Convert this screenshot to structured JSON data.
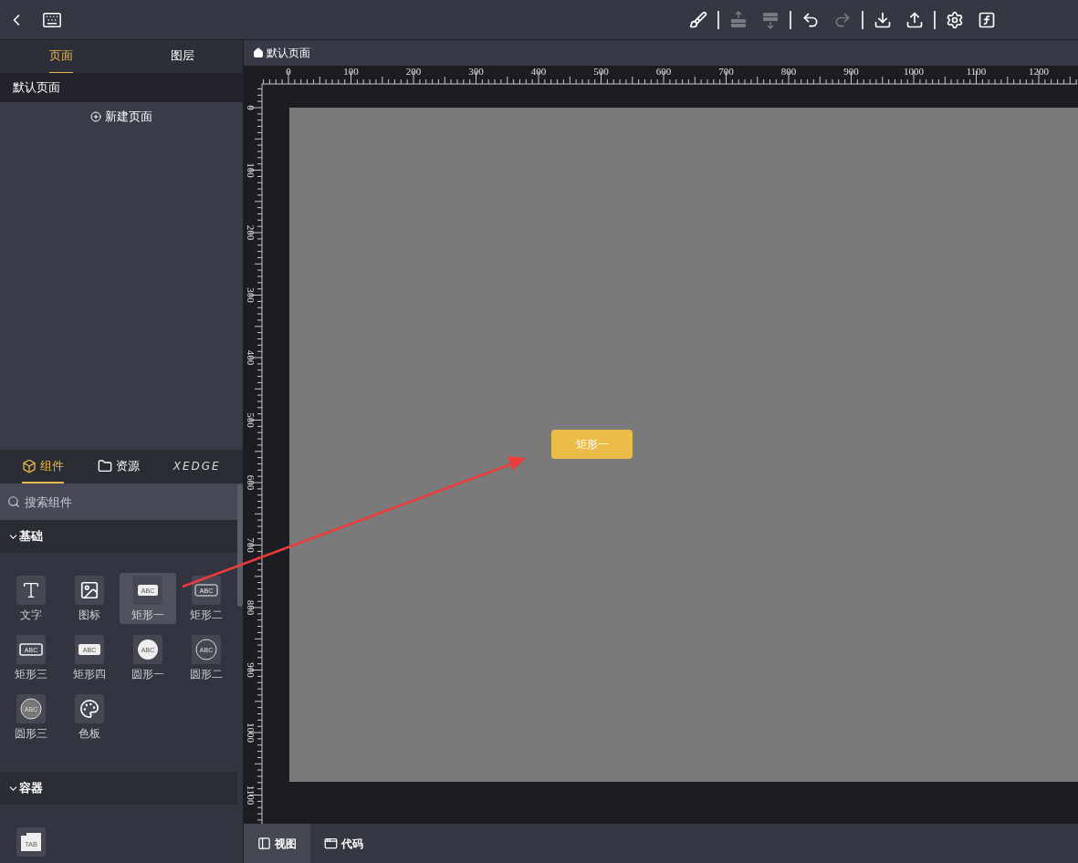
{
  "top_bar": {
    "toolbar": [
      {
        "kind": "brush",
        "disabled": false
      },
      {
        "kind": "separator"
      },
      {
        "kind": "layer-up",
        "disabled": true
      },
      {
        "kind": "layer-down",
        "disabled": true
      },
      {
        "kind": "separator"
      },
      {
        "kind": "undo",
        "disabled": false
      },
      {
        "kind": "redo",
        "disabled": true
      },
      {
        "kind": "separator"
      },
      {
        "kind": "download",
        "disabled": false
      },
      {
        "kind": "upload",
        "disabled": false
      },
      {
        "kind": "separator"
      },
      {
        "kind": "settings",
        "disabled": false
      },
      {
        "kind": "function",
        "disabled": false
      }
    ]
  },
  "left_panel": {
    "tabs": [
      {
        "label": "页面",
        "selected": true
      },
      {
        "label": "图层",
        "selected": false
      }
    ],
    "pages": [
      {
        "label": "默认页面",
        "selected": true
      }
    ],
    "new_page_button": "新建页面"
  },
  "library": {
    "tabs": [
      {
        "kind": "component",
        "label": "组件",
        "selected": true
      },
      {
        "kind": "folder",
        "label": "资源",
        "selected": false
      },
      {
        "kind": "logo",
        "label": "XEDGE",
        "selected": false
      }
    ],
    "search": {
      "placeholder": "搜索组件"
    },
    "sections": [
      {
        "title": "基础",
        "expanded": true,
        "items": [
          {
            "kind": "text",
            "label": "文字",
            "selected": false
          },
          {
            "kind": "image",
            "label": "图标",
            "selected": false
          },
          {
            "kind": "rect-filled",
            "glyph": "ABC",
            "label": "矩形一",
            "selected": true
          },
          {
            "kind": "rect-outline",
            "glyph": "ABC",
            "label": "矩形二",
            "selected": false
          },
          {
            "kind": "rect-outline-bold",
            "glyph": "ABC",
            "label": "矩形三",
            "selected": false
          },
          {
            "kind": "rect-wide",
            "glyph": "ABC",
            "label": "矩形四",
            "selected": false
          },
          {
            "kind": "circle-filled",
            "glyph": "ABC",
            "label": "圆形一",
            "selected": false
          },
          {
            "kind": "circle-outline",
            "glyph": "ABC",
            "label": "圆形二",
            "selected": false
          },
          {
            "kind": "circle-gray",
            "glyph": "ABC",
            "label": "圆形三",
            "selected": false
          },
          {
            "kind": "palette",
            "label": "色板",
            "selected": false
          }
        ]
      },
      {
        "title": "容器",
        "expanded": true,
        "items": [
          {
            "kind": "tab",
            "glyph": "TAB",
            "selected": false
          }
        ]
      }
    ]
  },
  "breadcrumb": "默认页面",
  "ruler": {
    "x_labels": [
      "0",
      "100",
      "200",
      "300",
      "400",
      "500",
      "600",
      "700",
      "800",
      "900",
      "1000",
      "1100",
      "1200"
    ],
    "y_labels": [
      "0",
      "100",
      "200",
      "300",
      "400",
      "500",
      "600",
      "700",
      "800",
      "900",
      "1000",
      "1100"
    ]
  },
  "canvas": {
    "widgets": [
      {
        "label": "矩形一"
      }
    ]
  },
  "bottom_tabs": [
    {
      "kind": "view",
      "label": "视图",
      "selected": true
    },
    {
      "kind": "code",
      "label": "代码",
      "selected": false
    }
  ]
}
